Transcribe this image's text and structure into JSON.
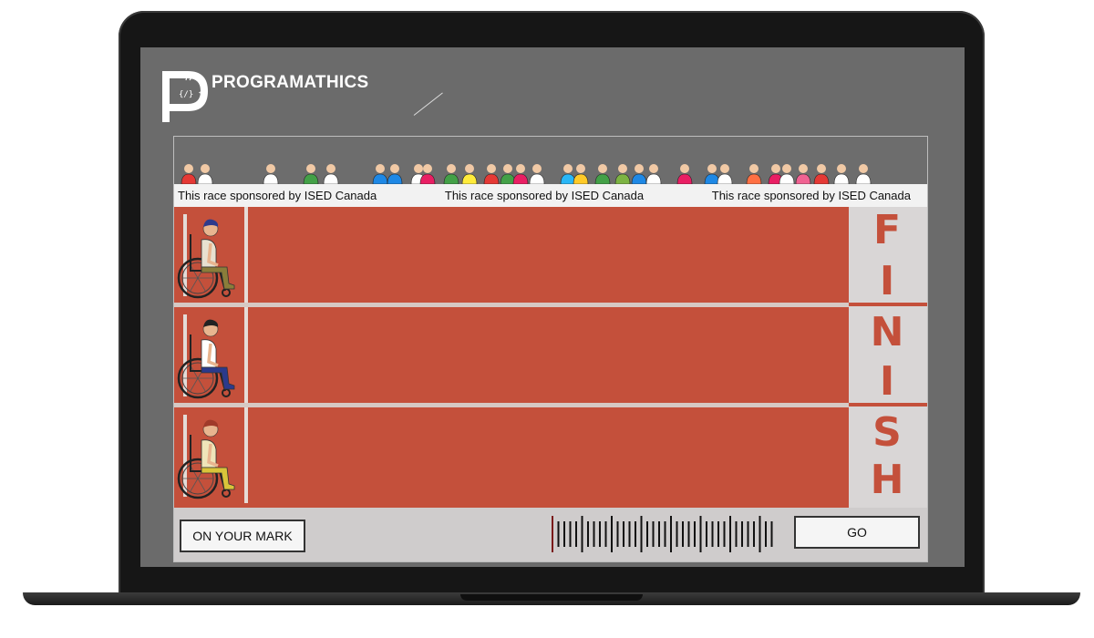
{
  "brand": {
    "name": "PROGRAMATHICS"
  },
  "banner": {
    "sponsors": [
      "This race sponsored by ISED Canada",
      "This race sponsored by ISED Canada",
      "This race sponsored by ISED Canada"
    ]
  },
  "finish": {
    "letters": [
      "F",
      "I",
      "N",
      "I",
      "S",
      "H"
    ]
  },
  "lanes": [
    {
      "racer": "wheelchair-racer",
      "shirt": "#e8e1d0",
      "pants": "#8a7d3a",
      "hair": "#2e3a8c"
    },
    {
      "racer": "wheelchair-racer",
      "shirt": "#ffffff",
      "pants": "#2b3a8c",
      "hair": "#222222"
    },
    {
      "racer": "wheelchair-racer",
      "shirt": "#efe5b9",
      "pants": "#d9c43a",
      "hair": "#a03a2a"
    }
  ],
  "controls": {
    "on_your_mark_label": "ON YOUR MARK",
    "go_label": "GO"
  },
  "colors": {
    "track": "#c4503b",
    "lane_line": "#d6c9c4",
    "finish_text": "#c4503b",
    "screen": "#6b6b6b"
  },
  "crowd": {
    "colors": [
      "#e53935",
      "#ffffff",
      "#ffffff",
      "#43a047",
      "#ffffff",
      "#1e88e5",
      "#1e88e5",
      "#ffffff",
      "#e91e63",
      "#43a047",
      "#ffeb3b",
      "#e53935",
      "#43a047",
      "#e91e63",
      "#ffffff",
      "#29b6f6",
      "#ffca28",
      "#43a047",
      "#7cb342",
      "#1e88e5",
      "#ffffff",
      "#e91e63",
      "#1e88e5",
      "#ffffff",
      "#ff7043",
      "#e91e63",
      "#ffffff",
      "#f06292",
      "#e53935",
      "#ffffff",
      "#ffffff"
    ]
  }
}
